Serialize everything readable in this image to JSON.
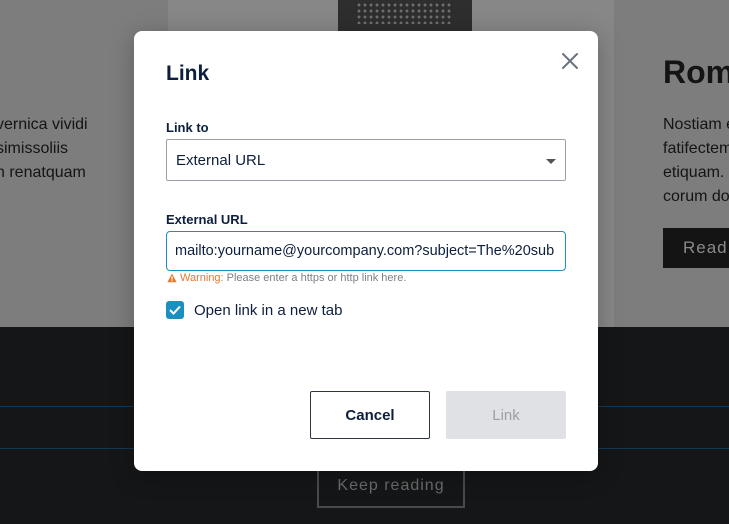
{
  "background": {
    "left_text": [
      "vernica vividi",
      "simissoliis",
      "n renatquam"
    ],
    "right_title": "Rom",
    "right_text": [
      "Nostiam e",
      "fatifectem",
      "etiquam.",
      "corum do"
    ],
    "read_button": "Read",
    "keep_reading_button": "Keep reading"
  },
  "modal": {
    "title": "Link",
    "close_icon": "close-icon",
    "link_to": {
      "label": "Link to",
      "selected": "External URL"
    },
    "external_url": {
      "label": "External URL",
      "value": "mailto:yourname@yourcompany.com?subject=The%20sub"
    },
    "warning": {
      "label": "Warning:",
      "text": "Please enter a https or http link here."
    },
    "new_tab": {
      "label": "Open link in a new tab",
      "checked": true
    },
    "buttons": {
      "cancel": "Cancel",
      "link": "Link"
    }
  },
  "colors": {
    "accent": "#1b8fc0",
    "warning": "#e6782e",
    "title": "#0d1f3c"
  }
}
